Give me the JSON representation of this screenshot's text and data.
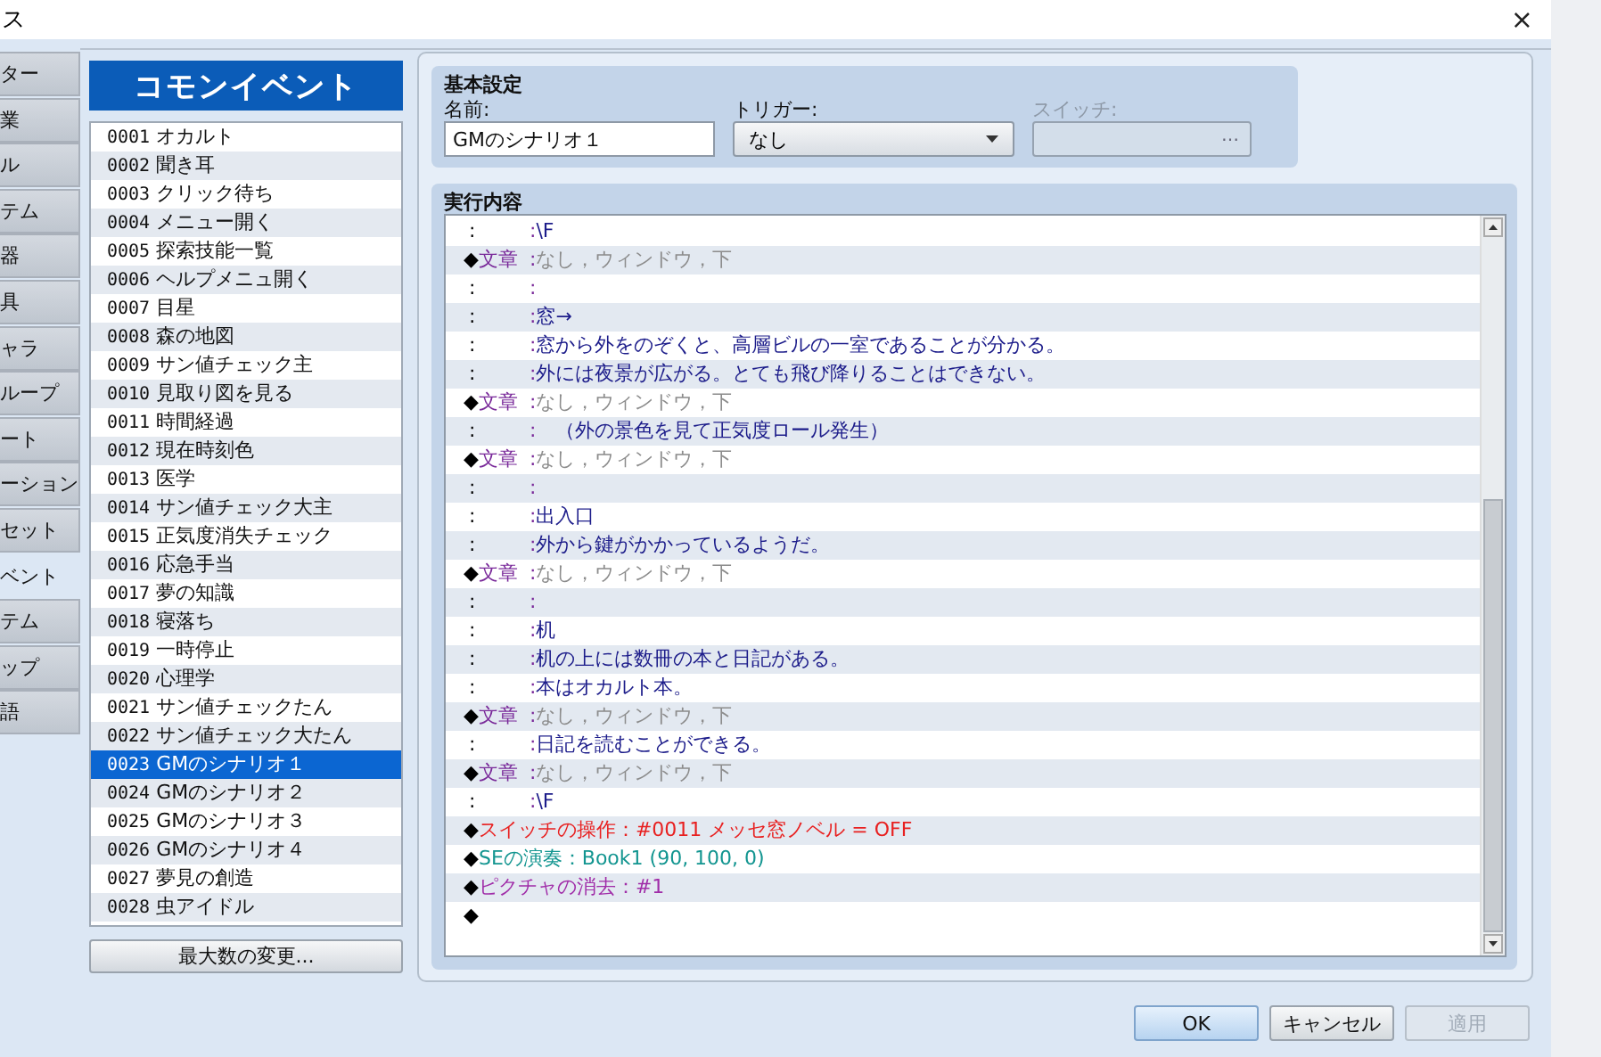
{
  "window": {
    "title": "ス",
    "close": "×"
  },
  "tabs": [
    {
      "label": "ター",
      "selected": false
    },
    {
      "label": "業",
      "selected": false
    },
    {
      "label": "ル",
      "selected": false
    },
    {
      "label": "テム",
      "selected": false
    },
    {
      "label": "器",
      "selected": false
    },
    {
      "label": "具",
      "selected": false
    },
    {
      "label": "ャラ",
      "selected": false
    },
    {
      "label": "ループ",
      "selected": false
    },
    {
      "label": "ート",
      "selected": false
    },
    {
      "label": "ーション",
      "selected": false
    },
    {
      "label": "セット",
      "selected": false
    },
    {
      "label": "ベント",
      "selected": true
    },
    {
      "label": "テム",
      "selected": false
    },
    {
      "label": "ップ",
      "selected": false
    },
    {
      "label": "語",
      "selected": false
    }
  ],
  "event_panel": {
    "title": "コモンイベント",
    "items": [
      {
        "id": "0001",
        "name": "オカルト",
        "selected": false
      },
      {
        "id": "0002",
        "name": "聞き耳",
        "selected": false
      },
      {
        "id": "0003",
        "name": "クリック待ち",
        "selected": false
      },
      {
        "id": "0004",
        "name": "メニュー開く",
        "selected": false
      },
      {
        "id": "0005",
        "name": "探索技能一覧",
        "selected": false
      },
      {
        "id": "0006",
        "name": "ヘルプメニュ開く",
        "selected": false
      },
      {
        "id": "0007",
        "name": "目星",
        "selected": false
      },
      {
        "id": "0008",
        "name": "森の地図",
        "selected": false
      },
      {
        "id": "0009",
        "name": "サン値チェック主",
        "selected": false
      },
      {
        "id": "0010",
        "name": "見取り図を見る",
        "selected": false
      },
      {
        "id": "0011",
        "name": "時間経過",
        "selected": false
      },
      {
        "id": "0012",
        "name": "現在時刻色",
        "selected": false
      },
      {
        "id": "0013",
        "name": "医学",
        "selected": false
      },
      {
        "id": "0014",
        "name": "サン値チェック大主",
        "selected": false
      },
      {
        "id": "0015",
        "name": "正気度消失チェック",
        "selected": false
      },
      {
        "id": "0016",
        "name": "応急手当",
        "selected": false
      },
      {
        "id": "0017",
        "name": "夢の知識",
        "selected": false
      },
      {
        "id": "0018",
        "name": "寝落ち",
        "selected": false
      },
      {
        "id": "0019",
        "name": "一時停止",
        "selected": false
      },
      {
        "id": "0020",
        "name": "心理学",
        "selected": false
      },
      {
        "id": "0021",
        "name": "サン値チェックたん",
        "selected": false
      },
      {
        "id": "0022",
        "name": "サン値チェック大たん",
        "selected": false
      },
      {
        "id": "0023",
        "name": "GMのシナリオ１",
        "selected": true
      },
      {
        "id": "0024",
        "name": "GMのシナリオ２",
        "selected": false
      },
      {
        "id": "0025",
        "name": "GMのシナリオ３",
        "selected": false
      },
      {
        "id": "0026",
        "name": "GMのシナリオ４",
        "selected": false
      },
      {
        "id": "0027",
        "name": "夢見の創造",
        "selected": false
      },
      {
        "id": "0028",
        "name": "虫アイドル",
        "selected": false
      }
    ],
    "max_button": "最大数の変更..."
  },
  "basic_settings": {
    "title": "基本設定",
    "name": {
      "label": "名前:",
      "value": "GMのシナリオ１"
    },
    "trigger": {
      "label": "トリガー:",
      "value": "なし"
    },
    "switch": {
      "label": "スイッチ:",
      "button": "…",
      "disabled": true
    }
  },
  "contents": {
    "title": "実行内容",
    "rows": [
      {
        "kind": "line",
        "marker": ":",
        "separator": ":",
        "text": "\\F"
      },
      {
        "kind": "message",
        "marker": "◆",
        "command": "文章",
        "separator": ":",
        "text": "なし，ウィンドウ，下"
      },
      {
        "kind": "line",
        "marker": ":",
        "separator": ":"
      },
      {
        "kind": "line",
        "marker": ":",
        "separator": ":",
        "text": "窓→"
      },
      {
        "kind": "line",
        "marker": ":",
        "separator": ":",
        "text": "窓から外をのぞくと、高層ビルの一室であることが分かる。"
      },
      {
        "kind": "line",
        "marker": ":",
        "separator": ":",
        "text": "外には夜景が広がる。とても飛び降りることはできない。"
      },
      {
        "kind": "message",
        "marker": "◆",
        "command": "文章",
        "separator": ":",
        "text": "なし，ウィンドウ，下"
      },
      {
        "kind": "line",
        "marker": ":",
        "separator": ":",
        "text": "　（外の景色を見て正気度ロール発生）"
      },
      {
        "kind": "message",
        "marker": "◆",
        "command": "文章",
        "separator": ":",
        "text": "なし，ウィンドウ，下"
      },
      {
        "kind": "line",
        "marker": ":",
        "separator": ":"
      },
      {
        "kind": "line",
        "marker": ":",
        "separator": ":",
        "text": "出入口"
      },
      {
        "kind": "line",
        "marker": ":",
        "separator": ":",
        "text": "外から鍵がかかっているようだ。"
      },
      {
        "kind": "message",
        "marker": "◆",
        "command": "文章",
        "separator": ":",
        "text": "なし，ウィンドウ，下"
      },
      {
        "kind": "line",
        "marker": ":",
        "separator": ":"
      },
      {
        "kind": "line",
        "marker": ":",
        "separator": ":",
        "text": "机"
      },
      {
        "kind": "line",
        "marker": ":",
        "separator": ":",
        "text": "机の上には数冊の本と日記がある。"
      },
      {
        "kind": "line",
        "marker": ":",
        "separator": ":",
        "text": "本はオカルト本。"
      },
      {
        "kind": "message",
        "marker": "◆",
        "command": "文章",
        "separator": ":",
        "text": "なし，ウィンドウ，下"
      },
      {
        "kind": "line",
        "marker": ":",
        "separator": ":",
        "text": "日記を読むことができる。"
      },
      {
        "kind": "message",
        "marker": "◆",
        "command": "文章",
        "separator": ":",
        "text": "なし，ウィンドウ，下"
      },
      {
        "kind": "line",
        "marker": ":",
        "separator": ":",
        "text": "\\F"
      },
      {
        "kind": "switch",
        "marker": "◆",
        "command": "スイッチの操作",
        "separator": "：",
        "text": "#0011 メッセ窓ノベル = OFF"
      },
      {
        "kind": "se",
        "marker": "◆",
        "command": "SEの演奏",
        "separator": "：",
        "text": "Book1 (90, 100, 0)"
      },
      {
        "kind": "picture",
        "marker": "◆",
        "command": "ピクチャの消去",
        "separator": "：",
        "text": "#1"
      },
      {
        "kind": "end",
        "marker": "◆"
      }
    ]
  },
  "buttons": [
    {
      "label": "OK",
      "default": true,
      "disabled": false
    },
    {
      "label": "キャンセル",
      "default": false,
      "disabled": false
    },
    {
      "label": "適用",
      "default": false,
      "disabled": true
    }
  ]
}
